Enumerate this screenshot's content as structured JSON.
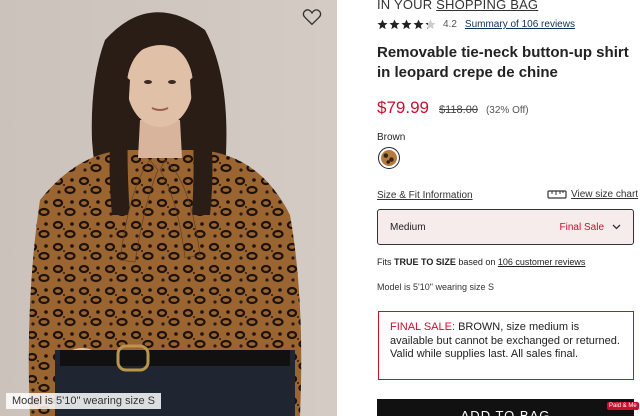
{
  "photo": {
    "caption": "Model is 5'10\" wearing size S",
    "heart_icon": "heart-outline-icon"
  },
  "header": {
    "eyebrow_prefix": "IN YOUR ",
    "eyebrow_link": "SHOPPING BAG"
  },
  "rating": {
    "value": "4.2",
    "stars": 4.2,
    "summary_link": "Summary of 106 reviews"
  },
  "product": {
    "title": "Removable tie-neck button-up shirt in leopard crepe de chine",
    "price": "$79.99",
    "original_price": "$118.00",
    "discount": "(32% Off)"
  },
  "color": {
    "label": "Brown"
  },
  "size": {
    "fit_link": "Size & Fit Information",
    "chart_link": "View size chart",
    "selected": "Medium",
    "final_sale": "Final Sale"
  },
  "fit_note": {
    "prefix": "Fits ",
    "bold": "TRUE TO SIZE",
    "middle": " based on ",
    "link": "106 customer reviews"
  },
  "model_note": "Model is 5'10\" wearing size S",
  "final_sale_box": {
    "label": "FINAL SALE:",
    "text": " BROWN, size medium is available but cannot be exchanged or returned. Valid while supplies last. All sales final."
  },
  "cta": {
    "add_to_bag": "ADD TO BAG"
  },
  "badge": {
    "text": "Paid & Me"
  },
  "colors": {
    "accent_red": "#c8102e",
    "select_bg": "#f6ecec",
    "button_bg": "#111111"
  }
}
